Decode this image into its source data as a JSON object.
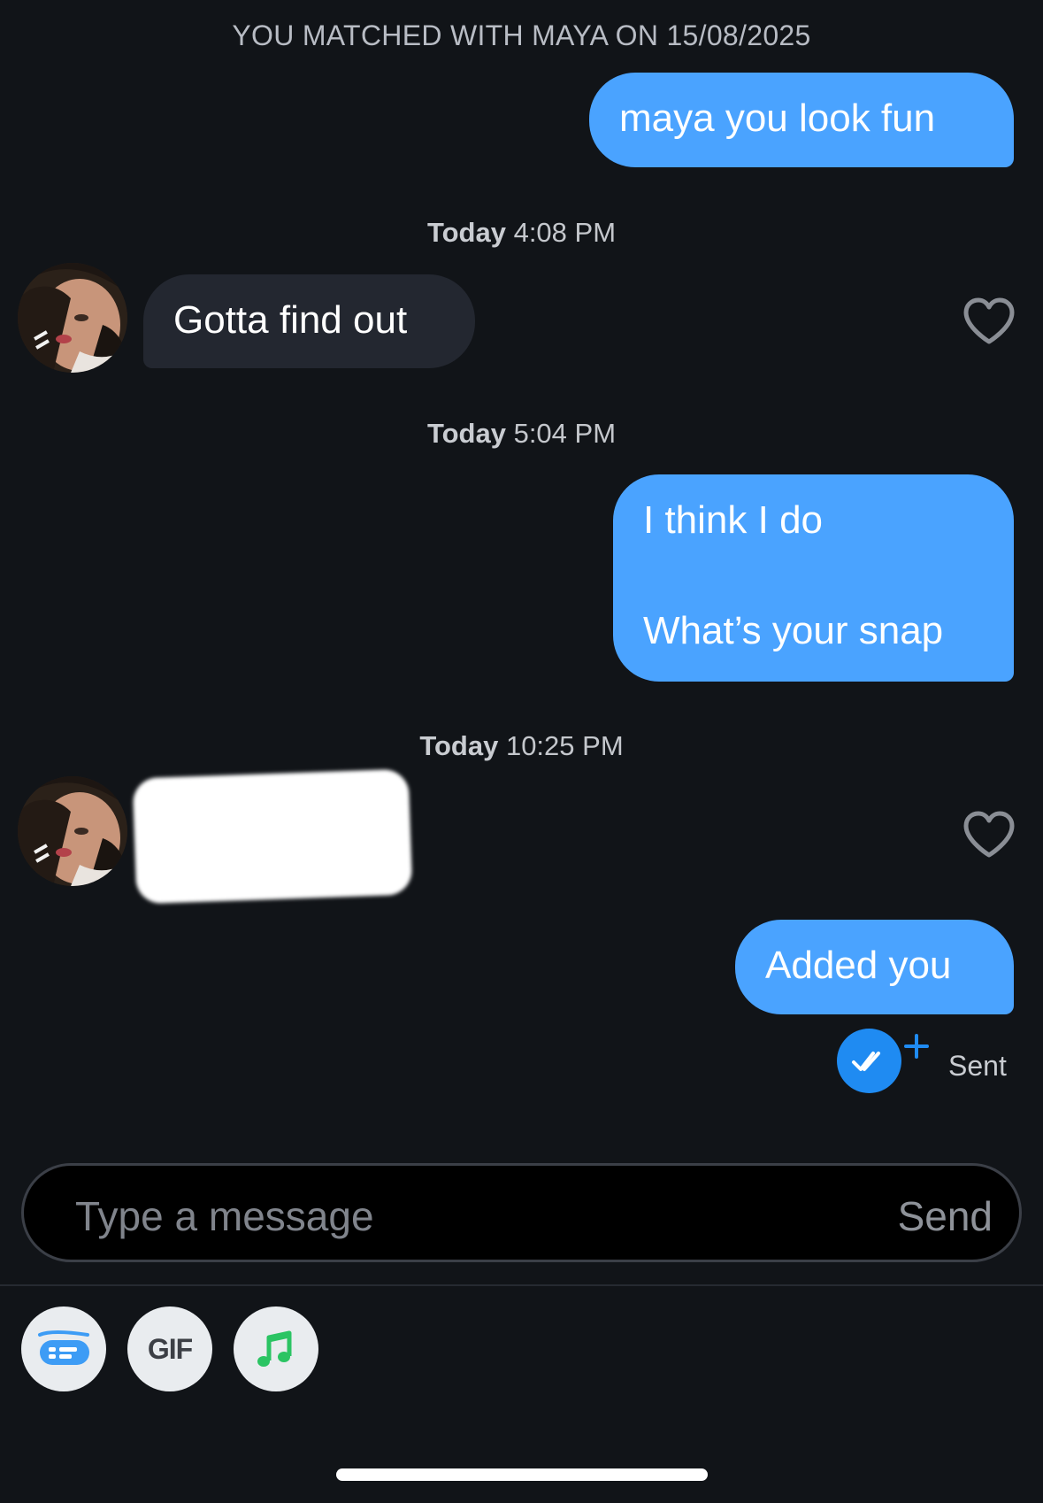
{
  "match_banner": "YOU MATCHED WITH MAYA ON 15/08/2025",
  "messages": [
    {
      "text": "maya you look fun"
    },
    {
      "day": "Today",
      "time": "4:08 PM"
    },
    {
      "text": "Gotta find out"
    },
    {
      "day": "Today",
      "time": "5:04 PM"
    },
    {
      "line1": "I think I do",
      "line2": "What’s your snap"
    },
    {
      "day": "Today",
      "time": "10:25 PM"
    },
    {
      "text": ""
    },
    {
      "text": "Added you",
      "status": "Sent"
    }
  ],
  "composer": {
    "placeholder": "Type a message",
    "send_label": "Send"
  },
  "toolbar": {
    "gif_label": "GIF",
    "icons": [
      "message-card-icon",
      "gif-icon",
      "music-note-icon"
    ]
  },
  "colors": {
    "background": "#111418",
    "outgoing_bubble": "#4aa3ff",
    "incoming_bubble": "#232730",
    "music_icon": "#2bc463",
    "card_icon": "#3d9cf5"
  }
}
